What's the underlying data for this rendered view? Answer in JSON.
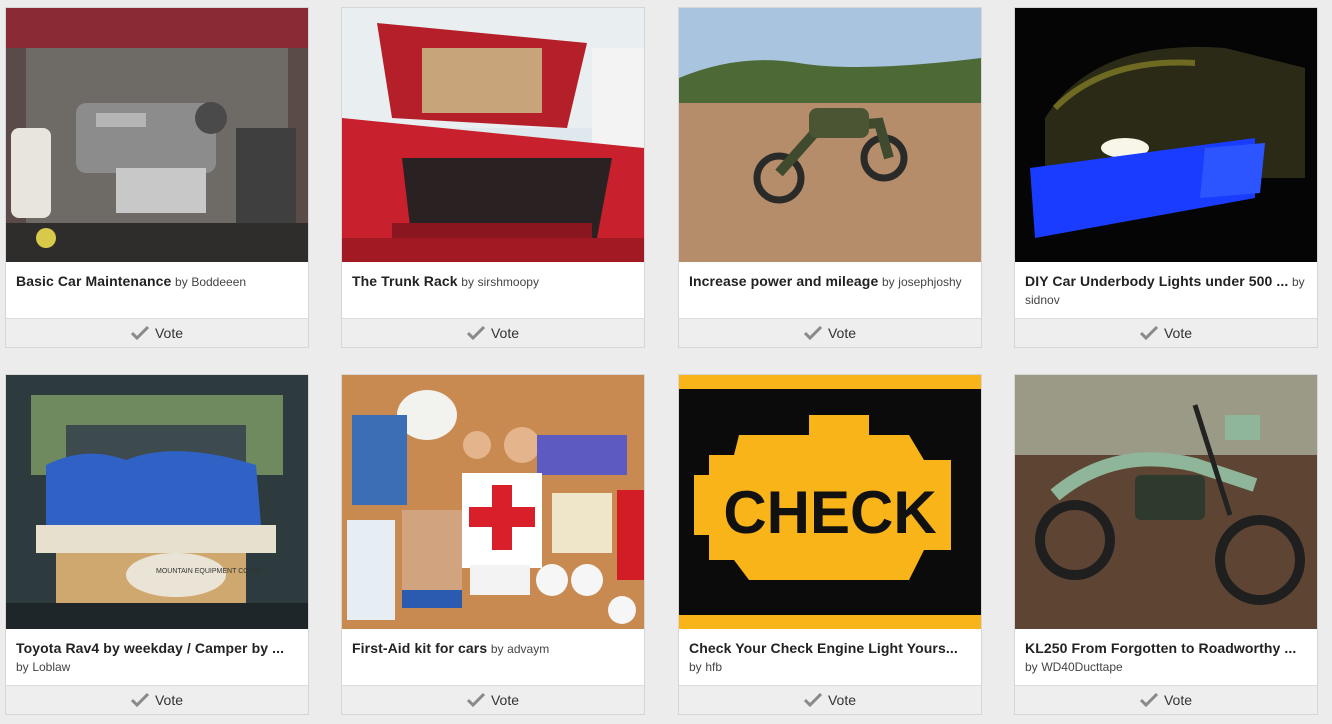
{
  "cards": [
    {
      "title": "Basic Car Maintenance",
      "by": "by",
      "author": "Boddeeen",
      "vote": "Vote"
    },
    {
      "title": "The Trunk Rack",
      "by": "by",
      "author": "sirshmoopy",
      "vote": "Vote"
    },
    {
      "title": "Increase power and mileage",
      "by": "by",
      "author": "josephjoshy",
      "vote": "Vote"
    },
    {
      "title": "DIY Car Underbody Lights under 500 ...",
      "by": "by",
      "author": "sidnov",
      "vote": "Vote"
    },
    {
      "title": "Toyota Rav4 by weekday / Camper by ...",
      "by": "by",
      "author": "Loblaw",
      "vote": "Vote"
    },
    {
      "title": "First-Aid kit for cars",
      "by": "by",
      "author": "advaym",
      "vote": "Vote"
    },
    {
      "title": "Check Your Check Engine Light Yours...",
      "by": "by",
      "author": "hfb",
      "vote": "Vote"
    },
    {
      "title": "KL250 From Forgotten to Roadworthy ...",
      "by": "by",
      "author": "WD40Ducttape",
      "vote": "Vote"
    }
  ],
  "image_text": {
    "check_sign": "CHECK",
    "sack_label": "MOUNTAIN EQUIPMENT CO-OP"
  },
  "colors": {
    "check_yellow": "#f8b418",
    "underglow_blue": "#1a3cff",
    "car_red": "#c8202c"
  }
}
